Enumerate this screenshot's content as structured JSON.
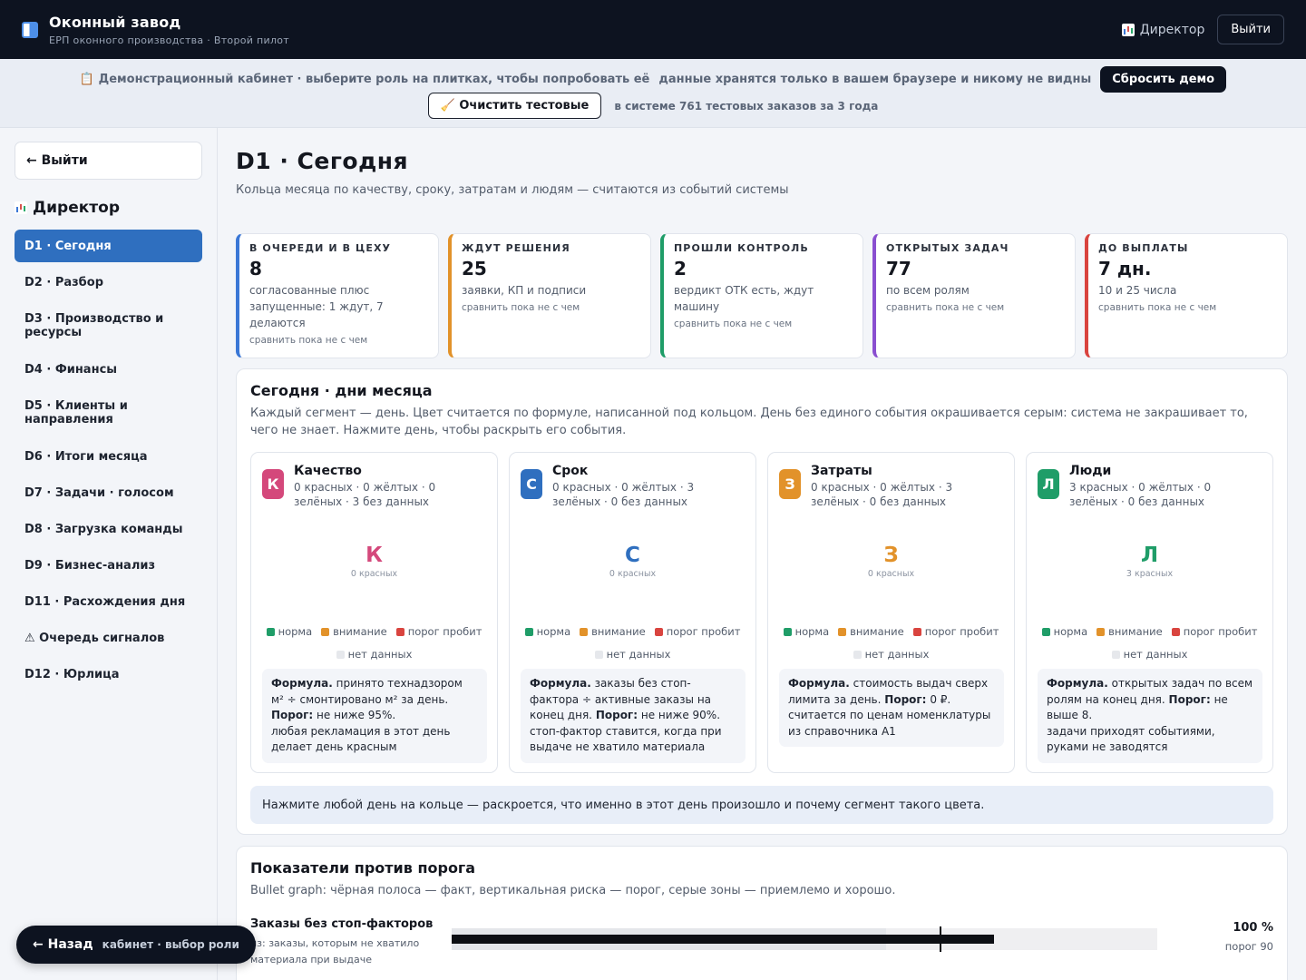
{
  "app": {
    "title": "Оконный завод",
    "subtitle": "ЕРП оконного производства · Второй пилот",
    "role_label": "Директор",
    "logout_label": "Выйти"
  },
  "banner": {
    "text": "📋 Демонстрационный кабинет · выберите роль на плитках, чтобы попробовать её",
    "note": "данные хранятся только в вашем браузере и никому не видны",
    "reset_label": "Сбросить демо",
    "clear_label": "🧹 Очистить тестовые",
    "count_text": "в системе 761 тестовых заказов за 3 года"
  },
  "sidebar": {
    "exit_label": "← Выйти",
    "role_title": "Директор",
    "items": [
      {
        "label": "D1 · Сегодня",
        "active": true,
        "tall": false
      },
      {
        "label": "D2 · Разбор",
        "active": false,
        "tall": false
      },
      {
        "label": "D3 · Производство и ресурсы",
        "active": false,
        "tall": true
      },
      {
        "label": "D4 · Финансы",
        "active": false,
        "tall": false
      },
      {
        "label": "D5 · Клиенты и направления",
        "active": false,
        "tall": true
      },
      {
        "label": "D6 · Итоги месяца",
        "active": false,
        "tall": false
      },
      {
        "label": "D7 · Задачи · голосом",
        "active": false,
        "tall": false
      },
      {
        "label": "D8 · Загрузка команды",
        "active": false,
        "tall": false
      },
      {
        "label": "D9 · Бизнес-анализ",
        "active": false,
        "tall": false
      },
      {
        "label": "D11 · Расхождения дня",
        "active": false,
        "tall": false
      },
      {
        "label": "⚠ Очередь сигналов",
        "active": false,
        "tall": false
      },
      {
        "label": "D12 · Юрлица",
        "active": false,
        "tall": false
      }
    ]
  },
  "page": {
    "title": "D1 · Сегодня",
    "subtitle": "Кольца месяца по качеству, сроку, затратам и людям — считаются из событий системы"
  },
  "kpis": [
    {
      "label": "В очереди и в цеху",
      "value": "8",
      "desc": "согласованные плюс запущенные: 1 ждут, 7 делаются",
      "compare": "сравнить пока не с чем",
      "color": "#3a77d6"
    },
    {
      "label": "Ждут решения",
      "value": "25",
      "desc": "заявки, КП и подписи",
      "compare": "сравнить пока не с чем",
      "color": "#e2922a"
    },
    {
      "label": "Прошли контроль",
      "value": "2",
      "desc": "вердикт ОТК есть, ждут машину",
      "compare": "сравнить пока не с чем",
      "color": "#1f9d68"
    },
    {
      "label": "Открытых задач",
      "value": "77",
      "desc": "по всем ролям",
      "compare": "сравнить пока не с чем",
      "color": "#8a4fd0"
    },
    {
      "label": "До выплаты",
      "value": "7 дн.",
      "desc": "10 и 25 числа",
      "compare": "сравнить пока не с чем",
      "color": "#d9443f"
    }
  ],
  "rings_section": {
    "title": "Сегодня · дни месяца",
    "description": "Каждый сегмент — день. Цвет считается по формуле, написанной под кольцом. День без единого события окрашивается серым: система не закрашивает то, чего не знает. Нажмите день, чтобы раскрыть его события.",
    "legend": {
      "norm": "норма",
      "attention": "внимание",
      "breach": "порог пробит",
      "nodata": "нет данных"
    },
    "legend_colors": {
      "norm": "#1f9d68",
      "attention": "#e2922a",
      "breach": "#d9443f",
      "nodata": "#e6e8ec"
    },
    "hint": "Нажмите любой день на кольце — раскроется, что именно в этот день произошло и почему сегмент такого цвета.",
    "rings": [
      {
        "letter": "К",
        "name": "Качество",
        "color": "#d4487b",
        "counts": "0 красных · 0 жёлтых · 0 зелёных · 3 без данных",
        "red_label": "0 красных",
        "formula_title": "Формула.",
        "formula": "принято технадзором м² ÷ смонтировано м² за день.",
        "threshold_label": "Порог:",
        "threshold": "не ниже 95%.",
        "note": "любая рекламация в этот день делает день красным"
      },
      {
        "letter": "С",
        "name": "Срок",
        "color": "#2f6fbf",
        "counts": "0 красных · 0 жёлтых · 3 зелёных · 0 без данных",
        "red_label": "0 красных",
        "formula_title": "Формула.",
        "formula": "заказы без стоп-фактора ÷ активные заказы на конец дня.",
        "threshold_label": "Порог:",
        "threshold": "не ниже 90%.",
        "note": "стоп-фактор ставится, когда при выдаче не хватило материала"
      },
      {
        "letter": "З",
        "name": "Затраты",
        "color": "#e2922a",
        "counts": "0 красных · 0 жёлтых · 3 зелёных · 0 без данных",
        "red_label": "0 красных",
        "formula_title": "Формула.",
        "formula": "стоимость выдач сверх лимита за день.",
        "threshold_label": "Порог:",
        "threshold": "0 ₽.",
        "note": "считается по ценам номенклатуры из справочника А1"
      },
      {
        "letter": "Л",
        "name": "Люди",
        "color": "#1f9d68",
        "counts": "3 красных · 0 жёлтых · 0 зелёных · 0 без данных",
        "red_label": "3 красных",
        "formula_title": "Формула.",
        "formula": "открытых задач по всем ролям на конец дня.",
        "threshold_label": "Порог:",
        "threshold": "не выше 8.",
        "note": "задачи приходят событиями, руками не заводятся"
      }
    ]
  },
  "bullets_section": {
    "title": "Показатели против порога",
    "description": "Bullet graph: чёрная полоса — факт, вертикальная риска — порог, серые зоны — приемлемо и хорошо.",
    "rows": [
      {
        "name": "Заказы без стоп-факторов",
        "hint": "из: заказы, которым не хватило материала при выдаче",
        "value_text": "100 %",
        "threshold_text": "порог 90",
        "value": 100,
        "threshold": 90,
        "max": 130,
        "zone_acceptable": 80,
        "zone_good": 130
      }
    ]
  },
  "back": {
    "label": "← Назад",
    "sub": "кабинет · выбор роли"
  }
}
